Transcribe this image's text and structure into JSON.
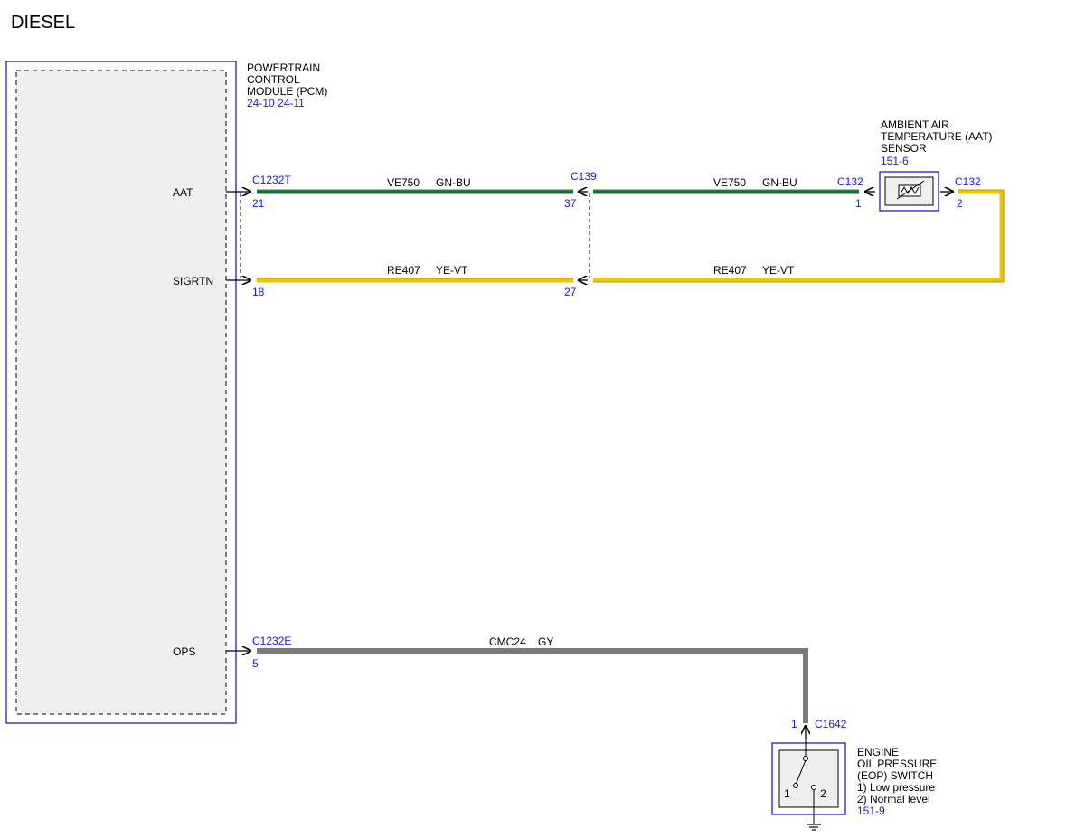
{
  "title": "DIESEL",
  "pcm": {
    "name_lines": [
      "POWERTRAIN",
      "CONTROL",
      "MODULE (PCM)"
    ],
    "refs": "24-10  24-11",
    "pins": {
      "aat": "AAT",
      "sigrtn": "SIGRTN",
      "ops": "OPS"
    }
  },
  "aat_sensor": {
    "name_lines": [
      "AMBIENT AIR",
      "TEMPERATURE (AAT)",
      "SENSOR"
    ],
    "ref": "151-6"
  },
  "eop_switch": {
    "name_lines": [
      "ENGINE",
      "OIL PRESSURE",
      "(EOP) SWITCH",
      "1) Low pressure",
      "2) Normal level"
    ],
    "ref": "151-9",
    "terminal_1": "1",
    "terminal_2": "2"
  },
  "connectors": {
    "c1232t": {
      "name": "C1232T",
      "pin_aat": "21",
      "pin_sigrtn": "18"
    },
    "c139": {
      "name": "C139",
      "pin_aat": "37",
      "pin_sigrtn": "27"
    },
    "c132_left": {
      "name": "C132",
      "pin": "1"
    },
    "c132_right": {
      "name": "C132",
      "pin": "2"
    },
    "c1232e": {
      "name": "C1232E",
      "pin": "5"
    },
    "c1642": {
      "name": "C1642",
      "pin": "1"
    }
  },
  "wires": {
    "aat_left": {
      "circuit": "VE750",
      "color_code": "GN-BU"
    },
    "aat_right": {
      "circuit": "VE750",
      "color_code": "GN-BU"
    },
    "sigrtn_left": {
      "circuit": "RE407",
      "color_code": "YE-VT"
    },
    "sigrtn_right": {
      "circuit": "RE407",
      "color_code": "YE-VT"
    },
    "ops": {
      "circuit": "CMC24",
      "color_code": "GY"
    }
  },
  "colors": {
    "green_wire": "#1e6b3a",
    "yellow_wire": "#f0c400",
    "gray_wire": "#7a7a7a",
    "component_outline": "#2a2ae0",
    "label_blue": "#1a1ae6"
  }
}
